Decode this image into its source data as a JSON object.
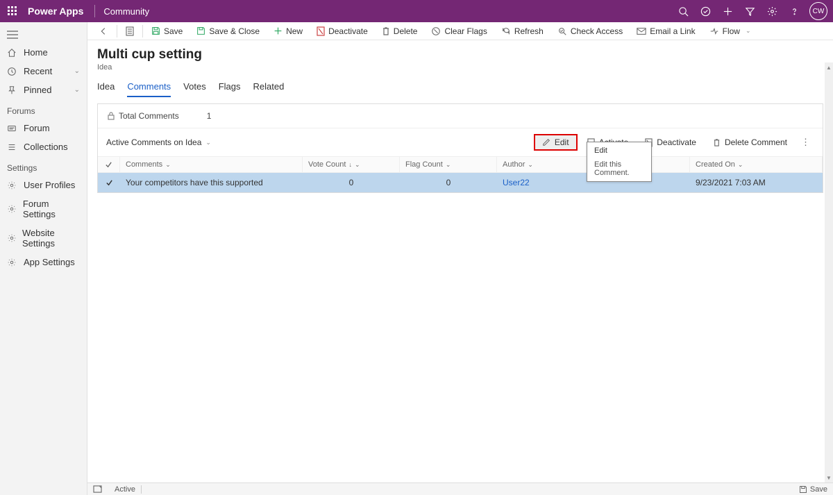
{
  "topbar": {
    "app_name": "Power Apps",
    "community": "Community",
    "avatar_initials": "CW"
  },
  "sidebar": {
    "home": "Home",
    "recent": "Recent",
    "pinned": "Pinned",
    "forums_hdr": "Forums",
    "forum": "Forum",
    "collections": "Collections",
    "settings_hdr": "Settings",
    "user_profiles": "User Profiles",
    "forum_settings": "Forum Settings",
    "website_settings": "Website Settings",
    "app_settings": "App Settings"
  },
  "cmdbar": {
    "save": "Save",
    "save_close": "Save & Close",
    "new": "New",
    "deactivate": "Deactivate",
    "delete": "Delete",
    "clear_flags": "Clear Flags",
    "refresh": "Refresh",
    "check_access": "Check Access",
    "email_link": "Email a Link",
    "flow": "Flow"
  },
  "page": {
    "title": "Multi cup setting",
    "subtitle": "Idea"
  },
  "tabs": {
    "idea": "Idea",
    "comments": "Comments",
    "votes": "Votes",
    "flags": "Flags",
    "related": "Related"
  },
  "panel": {
    "total_label": "Total Comments",
    "total_value": "1",
    "subgrid_title": "Active Comments on Idea"
  },
  "subgrid_actions": {
    "edit": "Edit",
    "activate": "Activate",
    "deactivate": "Deactivate",
    "delete_comment": "Delete Comment"
  },
  "table": {
    "headers": {
      "comments": "Comments",
      "vote_count": "Vote Count",
      "flag_count": "Flag Count",
      "author": "Author",
      "created_on": "Created On"
    },
    "row": {
      "comment": "Your competitors have this supported",
      "vote_count": "0",
      "flag_count": "0",
      "author": "User22",
      "created_on": "9/23/2021 7:03 AM"
    }
  },
  "tooltip": {
    "title": "Edit",
    "desc": "Edit this Comment."
  },
  "statusbar": {
    "status": "Active",
    "save": "Save"
  }
}
